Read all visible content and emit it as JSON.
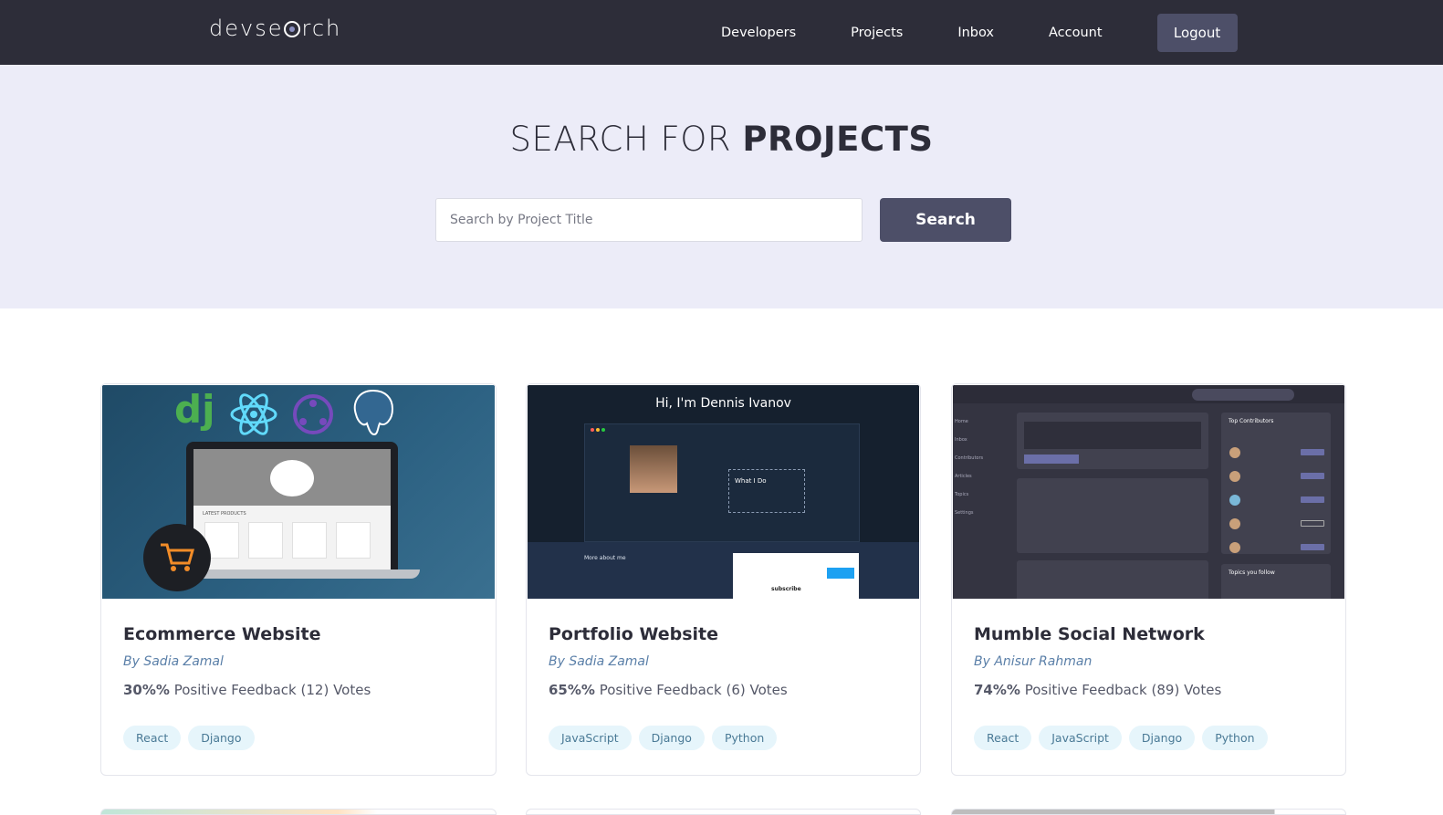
{
  "header": {
    "logo_left": "devse",
    "logo_right": "rch",
    "nav": [
      "Developers",
      "Projects",
      "Inbox",
      "Account"
    ],
    "logout_label": "Logout"
  },
  "hero": {
    "title_light": "SEARCH FOR ",
    "title_bold": "PROJECTS",
    "search_placeholder": "Search by Project Title",
    "search_button": "Search"
  },
  "projects": [
    {
      "title": "Ecommerce Website",
      "author": "By Sadia Zamal",
      "feedback_pct": "30%%",
      "feedback_text": "Positive Feedback (12) Votes",
      "tags": [
        "React",
        "Django"
      ]
    },
    {
      "title": "Portfolio Website",
      "author": "By Sadia Zamal",
      "feedback_pct": "65%%",
      "feedback_text": "Positive Feedback (6) Votes",
      "tags": [
        "JavaScript",
        "Django",
        "Python"
      ]
    },
    {
      "title": "Mumble Social Network",
      "author": "By Anisur Rahman",
      "feedback_pct": "74%%",
      "feedback_text": "Positive Feedback (89) Votes",
      "tags": [
        "React",
        "JavaScript",
        "Django",
        "Python"
      ]
    }
  ],
  "thumbnails": {
    "ecommerce": {
      "logo_text": "dj",
      "section_label": "LATEST PRODUCTS",
      "icon": "shopping-cart-icon"
    },
    "portfolio": {
      "heading": "Hi, I'm Dennis Ivanov",
      "box_title": "What I Do",
      "more_label": "More about me",
      "button_label": "subscribe"
    },
    "mumble": {
      "sidebar": [
        "Home",
        "Inbox",
        "Contributors",
        "Articles",
        "Topics",
        "Settings"
      ],
      "panel_title": "Top Contributors",
      "panel2_title": "Topics you follow"
    }
  },
  "colors": {
    "header_bg": "#2d2d39",
    "hero_bg": "#ececf8",
    "button_bg": "#4d4f68",
    "tag_bg": "#e6f5fb",
    "author": "#5a7fa8"
  }
}
